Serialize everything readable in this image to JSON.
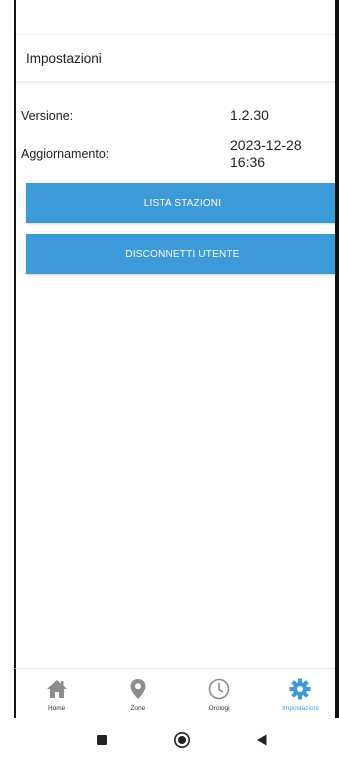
{
  "header": {
    "title": "Impostazioni"
  },
  "info": {
    "version_label": "Versione:",
    "version_value": "1.2.30",
    "update_label": "Aggiornamento:",
    "update_date": "2023-12-28",
    "update_time": "16:36"
  },
  "buttons": {
    "stations_label": "LISTA STAZIONI",
    "logout_label": "DISCONNETTI UTENTE"
  },
  "tabbar": {
    "items": [
      {
        "label": "Home",
        "icon": "home-icon",
        "active": false
      },
      {
        "label": "Zone",
        "icon": "map-pin-icon",
        "active": false
      },
      {
        "label": "Orologi",
        "icon": "clock-icon",
        "active": false
      },
      {
        "label": "Impostazioni",
        "icon": "gear-icon",
        "active": true
      }
    ]
  },
  "colors": {
    "accent": "#3d9ad9",
    "tab_inactive_icon": "#8c8c8c",
    "tab_active_icon": "#3d9ad9"
  },
  "system_nav": {
    "icons": [
      "recents-icon",
      "home-circle-icon",
      "back-icon"
    ]
  }
}
